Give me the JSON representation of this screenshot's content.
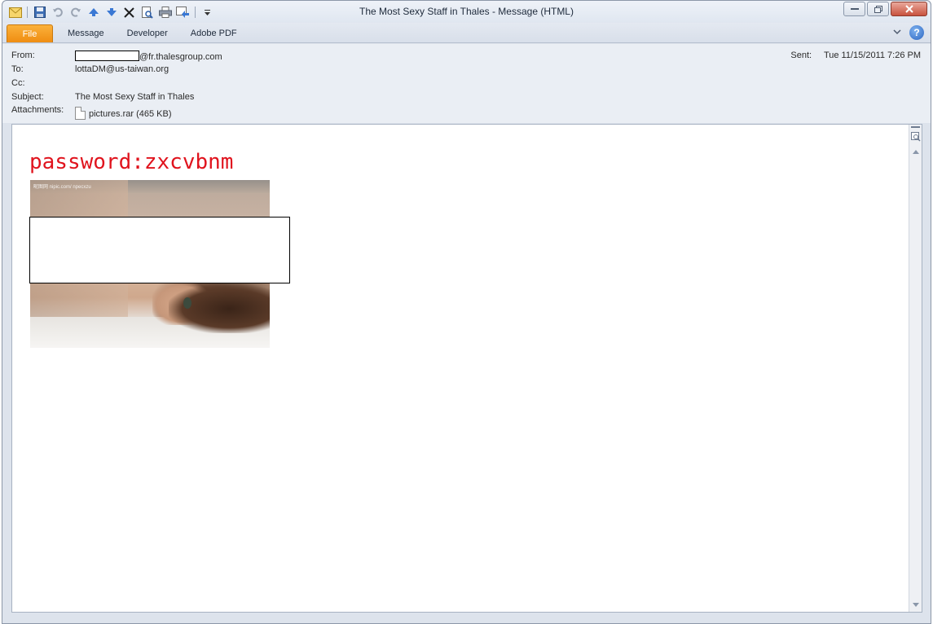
{
  "window": {
    "title": "The Most Sexy Staff in Thales  -  Message (HTML)"
  },
  "quick_access": [
    {
      "name": "envelope-icon"
    },
    {
      "name": "save-icon"
    },
    {
      "name": "undo-icon"
    },
    {
      "name": "redo-icon"
    },
    {
      "name": "previous-item-icon"
    },
    {
      "name": "next-item-icon"
    },
    {
      "name": "delete-icon"
    },
    {
      "name": "print-preview-icon"
    },
    {
      "name": "print-icon"
    },
    {
      "name": "reply-icon"
    },
    {
      "name": "customize-dropdown-icon"
    }
  ],
  "ribbon": {
    "tabs": [
      "File",
      "Message",
      "Developer",
      "Adobe PDF"
    ]
  },
  "header": {
    "from_label": "From:",
    "from_domain": "@fr.thalesgroup.com",
    "to_label": "To:",
    "to_value": "lottaDM@us-taiwan.org",
    "cc_label": "Cc:",
    "cc_value": "",
    "subject_label": "Subject:",
    "subject_value": "The Most Sexy Staff in Thales",
    "attachments_label": "Attachments:",
    "attachment_name": "pictures.rar (465 KB)",
    "sent_label": "Sent:",
    "sent_value": "Tue 11/15/2011 7:26 PM"
  },
  "body": {
    "password_text": "password:zxcvbnm",
    "image_watermark": "昵图网 nipic.com/ npecxzu"
  },
  "colors": {
    "password_red": "#e0141e",
    "file_tab_orange": "#ef8d12"
  }
}
